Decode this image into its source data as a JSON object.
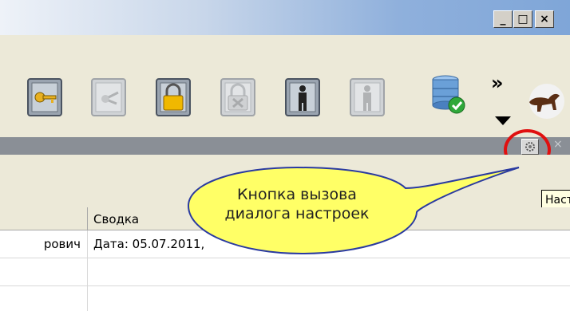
{
  "window": {
    "minimize_symbol": "_",
    "maximize_symbol": "□",
    "close_symbol": "×"
  },
  "toolbar": {
    "buttons": [
      {
        "icon": "key-safe-icon",
        "enabled": true
      },
      {
        "icon": "broken-key-safe-icon",
        "enabled": false
      },
      {
        "icon": "padlock-safe-icon",
        "enabled": true
      },
      {
        "icon": "unlock-safe-icon",
        "enabled": false
      },
      {
        "icon": "person-door-icon",
        "enabled": true
      },
      {
        "icon": "person-door-icon",
        "enabled": false
      },
      {
        "icon": "server-check-icon",
        "enabled": true
      }
    ],
    "more_symbol": "»"
  },
  "panel": {
    "close_symbol": "×",
    "settings_tooltip": "Наст"
  },
  "grid": {
    "columns": [
      "",
      "Сводка"
    ],
    "rows": [
      [
        "рович",
        "Дата: 05.07.2011,"
      ],
      [
        "",
        ""
      ],
      [
        "",
        ""
      ]
    ]
  },
  "callout": {
    "line1": "Кнопка вызова",
    "line2": "диалога настроек"
  },
  "colors": {
    "accent_ring": "#e01010",
    "balloon_fill": "#ffff66",
    "titlebar": "#7fa6d8"
  }
}
